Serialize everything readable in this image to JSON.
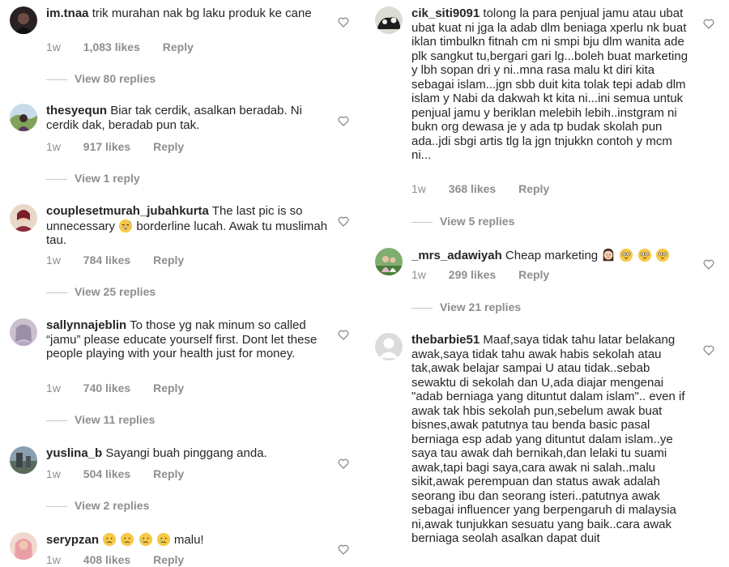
{
  "left": [
    {
      "username": "im.tnaa",
      "text": "trik murahan nak bg laku produk ke cane",
      "time": "1w",
      "likes": "1,083 likes",
      "reply": "Reply",
      "replies": "View 80 replies"
    },
    {
      "username": "thesyequn",
      "text": "Biar tak cerdik, asalkan beradab. Ni cerdik dak, beradab pun tak.",
      "time": "1w",
      "likes": "917 likes",
      "reply": "Reply",
      "replies": "View 1 reply"
    },
    {
      "username": "couplesetmurah_jubahkurta",
      "text_a": "The last pic is so unnecessary",
      "text_b": "borderline lucah. Awak tu muslimah tau.",
      "time": "1w",
      "likes": "784 likes",
      "reply": "Reply",
      "replies": "View 25 replies"
    },
    {
      "username": "sallynnajeblin",
      "text": "To those yg nak minum so called “jamu” please educate yourself first. Dont let these people playing with your health just for money.",
      "time": "1w",
      "likes": "740 likes",
      "reply": "Reply",
      "replies": "View 11 replies"
    },
    {
      "username": "yuslina_b",
      "text": "Sayangi buah pinggang anda.",
      "time": "1w",
      "likes": "504 likes",
      "reply": "Reply",
      "replies": "View 2 replies"
    },
    {
      "username": "serypzan",
      "text_b": "malu!",
      "time": "1w",
      "likes": "408 likes",
      "reply": "Reply"
    }
  ],
  "right": [
    {
      "username": "cik_siti9091",
      "text": "tolong la para penjual jamu atau ubat ubat kuat ni jga la adab dlm beniaga xperlu nk buat iklan timbulkn fitnah cm ni smpi bju dlm wanita ade plk sangkut tu,bergari gari lg...boleh buat marketing y lbh sopan dri y ni..mna rasa malu kt diri kita sebagai islam...jgn sbb duit kita tolak tepi adab dlm islam y Nabi da dakwah kt kita ni...ini semua untuk penjual jamu y beriklan melebih lebih..instgram ni bukn org dewasa je y ada tp budak skolah pun ada..jdi sbgi artis tlg la jgn tnjukkn contoh y mcm ni...",
      "time": "1w",
      "likes": "368 likes",
      "reply": "Reply",
      "replies": "View 5 replies"
    },
    {
      "username": "_mrs_adawiyah",
      "text": "Cheap marketing",
      "time": "1w",
      "likes": "299 likes",
      "reply": "Reply",
      "replies": "View 21 replies"
    },
    {
      "username": "thebarbie51",
      "text": "Maaf,saya tidak tahu latar belakang awak,saya tidak tahu awak habis sekolah atau tak,awak belajar sampai U atau tidak..sebab sewaktu di sekolah dan U,ada diajar mengenai \"adab berniaga yang dituntut dalam islam\".. even if awak tak hbis sekolah pun,sebelum awak buat bisnes,awak patutnya tau benda basic pasal berniaga esp adab yang dituntut dalam islam..ye saya tau awak dah bernikah,dan lelaki tu suami awak,tapi bagi saya,cara awak ni salah..malu sikit,awak perempuan dan status awak adalah seorang ibu dan seorang isteri..patutnya awak sebagai influencer yang berpengaruh di malaysia ni,awak tunjukkan sesuatu yang baik..cara awak berniaga seolah asalkan dapat duit"
    }
  ]
}
